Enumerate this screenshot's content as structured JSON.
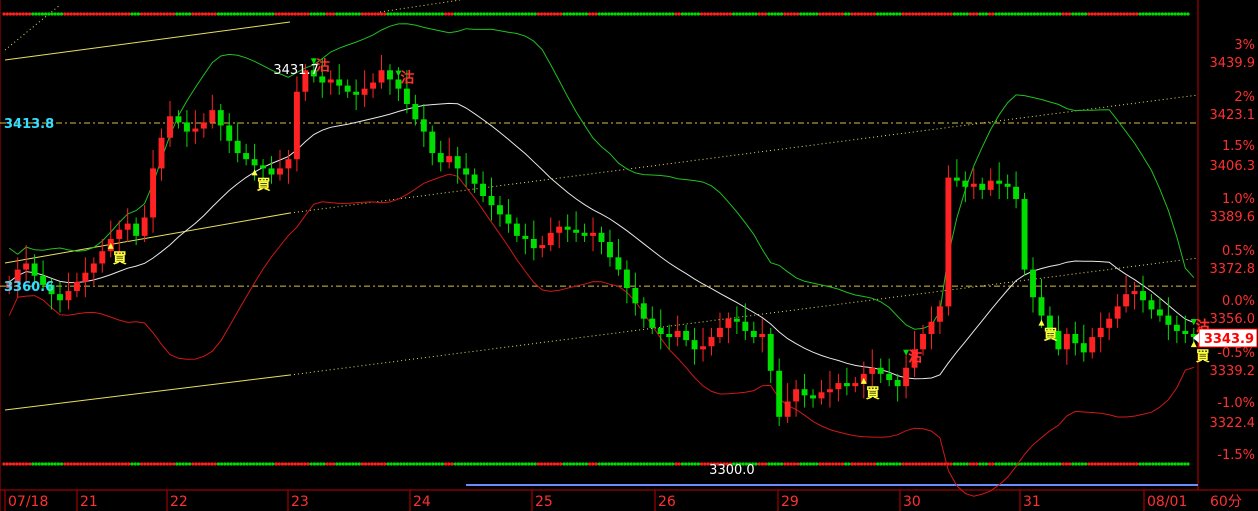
{
  "chart_data": {
    "type": "candlestick",
    "x_dates": [
      "07/18",
      "21",
      "22",
      "23",
      "24",
      "25",
      "26",
      "29",
      "30",
      "31",
      "08/01"
    ],
    "timeframe_label": "60分",
    "y_range": [
      3300,
      3450
    ],
    "right_axis_prices": [
      "3439.9",
      "3423.1",
      "3406.3",
      "3389.6",
      "3372.8",
      "3356.0",
      "3339.2",
      "3322.4"
    ],
    "right_axis_percents": [
      "3%",
      "2%",
      "1.5%",
      "1.0%",
      "0.5%",
      "0.0%",
      "-0.5%",
      "-1.0%",
      "-1.5%"
    ],
    "current_price": "3343.9",
    "highlighted_prices": [
      "3413.8",
      "3360.6"
    ],
    "annotations": {
      "high_label": "3431.7",
      "low_label": "3300.0"
    },
    "signals": [
      {
        "text": "買",
        "bar": 12,
        "kind": "buy"
      },
      {
        "text": "沽",
        "bar": 36,
        "kind": "sell"
      },
      {
        "text": "買",
        "bar": 29,
        "kind": "buy"
      },
      {
        "text": "沽",
        "bar": 46,
        "kind": "sell"
      },
      {
        "text": "買",
        "bar": 101,
        "kind": "buy"
      },
      {
        "text": "沽",
        "bar": 106,
        "kind": "sell"
      },
      {
        "text": "買",
        "bar": 122,
        "kind": "buy"
      },
      {
        "text": "沽",
        "bar": 142,
        "kind": "sell"
      },
      {
        "text": "買",
        "bar": 156,
        "kind": "buy"
      },
      {
        "text": "沽",
        "bar": 161,
        "kind": "sell"
      }
    ],
    "closes": [
      3362,
      3366,
      3368,
      3364,
      3361,
      3358,
      3356,
      3359,
      3362,
      3365,
      3368,
      3372,
      3376,
      3379,
      3381,
      3377,
      3383,
      3399,
      3409,
      3416,
      3414,
      3411,
      3412,
      3414,
      3418,
      3413,
      3408,
      3404,
      3402,
      3400,
      3399,
      3397,
      3399,
      3402,
      3424,
      3431,
      3429,
      3427,
      3428,
      3426,
      3424,
      3423,
      3425,
      3427,
      3431,
      3428,
      3425,
      3420,
      3415,
      3411,
      3404,
      3401,
      3403,
      3399,
      3397,
      3394,
      3390,
      3387,
      3384,
      3381,
      3377,
      3376,
      3373,
      3374,
      3378,
      3380,
      3379,
      3378,
      3377,
      3378,
      3375,
      3370,
      3366,
      3360,
      3355,
      3350,
      3347,
      3345,
      3344,
      3346,
      3343,
      3340,
      3341,
      3344,
      3347,
      3350,
      3349,
      3346,
      3344,
      3345,
      3333,
      3318,
      3323,
      3327,
      3325,
      3324,
      3326,
      3327,
      3329,
      3328,
      3329,
      3332,
      3334,
      3332,
      3330,
      3328,
      3334,
      3340,
      3345,
      3349,
      3354,
      3396,
      3395,
      3393,
      3394,
      3392,
      3395,
      3394,
      3393,
      3389,
      3366,
      3357,
      3351,
      3346,
      3340,
      3345,
      3342,
      3339,
      3344,
      3347,
      3350,
      3354,
      3358,
      3359,
      3356,
      3353,
      3351,
      3348,
      3346,
      3345,
      3344
    ]
  }
}
